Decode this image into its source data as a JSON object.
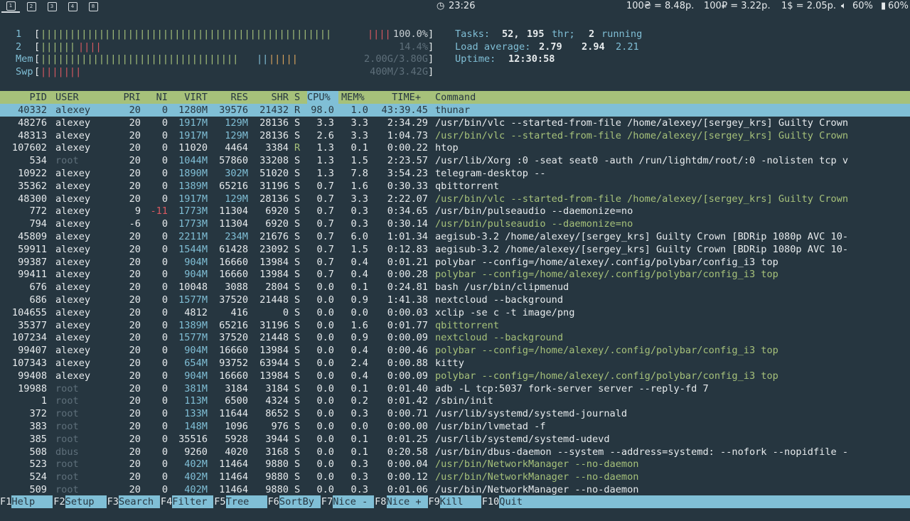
{
  "topbar": {
    "workspaces": [
      "1",
      "2",
      "3",
      "4",
      "8"
    ],
    "clock": "23:26",
    "rate_uah": "100₴ = 8.48р.",
    "rate_rub": "100₽ = 3.22р.",
    "rate_usd": "1$ = 2.05р.",
    "volume": "60%",
    "battery": "60%"
  },
  "meters": {
    "cpu1": {
      "label": "1",
      "value": "100.0%"
    },
    "cpu2": {
      "label": "2",
      "value": "14.4%"
    },
    "mem": {
      "label": "Mem",
      "value": "2.00G/3.80G"
    },
    "swp": {
      "label": "Swp",
      "value": "400M/3.42G"
    }
  },
  "summary": {
    "tasks_label": "Tasks:",
    "tasks_count": "52,",
    "thr_count": "195",
    "thr_label": "thr;",
    "running_count": "2",
    "running_label": "running",
    "load_label": "Load average:",
    "load1": "2.79",
    "load5": "2.94",
    "load15": "2.21",
    "uptime_label": "Uptime:",
    "uptime": "12:30:58"
  },
  "columns": {
    "pid": "PID",
    "user": "USER",
    "pri": "PRI",
    "ni": "NI",
    "virt": "VIRT",
    "res": "RES",
    "shr": "SHR",
    "s": "S",
    "cpu": "CPU%",
    "mem": "MEM%",
    "time": "TIME+",
    "command": "Command"
  },
  "processes": [
    {
      "pid": "40332",
      "user": "alexey",
      "pri": "20",
      "ni": "0",
      "virt": "1280M",
      "res": "39576",
      "shr": "21432",
      "s": "R",
      "cpu": "98.0",
      "mem": "1.0",
      "time": "43:39.45",
      "command": "thunar",
      "selected": true
    },
    {
      "pid": "48276",
      "user": "alexey",
      "pri": "20",
      "ni": "0",
      "virt": "1917M",
      "res": "129M",
      "shr": "28136",
      "s": "S",
      "cpu": "3.3",
      "mem": "3.3",
      "time": "2:34.29",
      "command": "/usr/bin/vlc --started-from-file /home/alexey/[sergey_krs] Guilty Crown"
    },
    {
      "pid": "48313",
      "user": "alexey",
      "pri": "20",
      "ni": "0",
      "virt": "1917M",
      "res": "129M",
      "shr": "28136",
      "s": "S",
      "cpu": "2.6",
      "mem": "3.3",
      "time": "1:04.73",
      "command": "/usr/bin/vlc --started-from-file /home/alexey/[sergey_krs] Guilty Crown",
      "thread": true
    },
    {
      "pid": "107602",
      "user": "alexey",
      "pri": "20",
      "ni": "0",
      "virt": "11020",
      "res": "4464",
      "shr": "3384",
      "s": "R",
      "cpu": "1.3",
      "mem": "0.1",
      "time": "0:00.22",
      "command": "htop"
    },
    {
      "pid": "534",
      "user": "root",
      "pri": "20",
      "ni": "0",
      "virt": "1044M",
      "res": "57860",
      "shr": "33208",
      "s": "S",
      "cpu": "1.3",
      "mem": "1.5",
      "time": "2:23.57",
      "command": "/usr/lib/Xorg :0 -seat seat0 -auth /run/lightdm/root/:0 -nolisten tcp v"
    },
    {
      "pid": "10922",
      "user": "alexey",
      "pri": "20",
      "ni": "0",
      "virt": "1890M",
      "res": "302M",
      "shr": "51020",
      "s": "S",
      "cpu": "1.3",
      "mem": "7.8",
      "time": "3:54.23",
      "command": "telegram-desktop --"
    },
    {
      "pid": "35362",
      "user": "alexey",
      "pri": "20",
      "ni": "0",
      "virt": "1389M",
      "res": "65216",
      "shr": "31196",
      "s": "S",
      "cpu": "0.7",
      "mem": "1.6",
      "time": "0:30.33",
      "command": "qbittorrent"
    },
    {
      "pid": "48300",
      "user": "alexey",
      "pri": "20",
      "ni": "0",
      "virt": "1917M",
      "res": "129M",
      "shr": "28136",
      "s": "S",
      "cpu": "0.7",
      "mem": "3.3",
      "time": "2:22.07",
      "command": "/usr/bin/vlc --started-from-file /home/alexey/[sergey_krs] Guilty Crown",
      "thread": true
    },
    {
      "pid": "772",
      "user": "alexey",
      "pri": "9",
      "ni": "-11",
      "virt": "1773M",
      "res": "11304",
      "shr": "6920",
      "s": "S",
      "cpu": "0.7",
      "mem": "0.3",
      "time": "0:34.65",
      "command": "/usr/bin/pulseaudio --daemonize=no"
    },
    {
      "pid": "794",
      "user": "alexey",
      "pri": "-6",
      "ni": "0",
      "virt": "1773M",
      "res": "11304",
      "shr": "6920",
      "s": "S",
      "cpu": "0.7",
      "mem": "0.3",
      "time": "0:30.14",
      "command": "/usr/bin/pulseaudio --daemonize=no",
      "thread": true
    },
    {
      "pid": "45809",
      "user": "alexey",
      "pri": "20",
      "ni": "0",
      "virt": "2211M",
      "res": "234M",
      "shr": "21676",
      "s": "S",
      "cpu": "0.7",
      "mem": "6.0",
      "time": "1:01.34",
      "command": "aegisub-3.2 /home/alexey/[sergey_krs] Guilty Crown [BDRip 1080p AVC 10-"
    },
    {
      "pid": "59911",
      "user": "alexey",
      "pri": "20",
      "ni": "0",
      "virt": "1544M",
      "res": "61428",
      "shr": "23092",
      "s": "S",
      "cpu": "0.7",
      "mem": "1.5",
      "time": "0:12.83",
      "command": "aegisub-3.2 /home/alexey/[sergey_krs] Guilty Crown [BDRip 1080p AVC 10-"
    },
    {
      "pid": "99387",
      "user": "alexey",
      "pri": "20",
      "ni": "0",
      "virt": "904M",
      "res": "16660",
      "shr": "13984",
      "s": "S",
      "cpu": "0.7",
      "mem": "0.4",
      "time": "0:01.21",
      "command": "polybar --config=/home/alexey/.config/polybar/config_i3 top"
    },
    {
      "pid": "99411",
      "user": "alexey",
      "pri": "20",
      "ni": "0",
      "virt": "904M",
      "res": "16660",
      "shr": "13984",
      "s": "S",
      "cpu": "0.7",
      "mem": "0.4",
      "time": "0:00.28",
      "command": "polybar --config=/home/alexey/.config/polybar/config_i3 top",
      "thread": true
    },
    {
      "pid": "676",
      "user": "alexey",
      "pri": "20",
      "ni": "0",
      "virt": "10048",
      "res": "3088",
      "shr": "2804",
      "s": "S",
      "cpu": "0.0",
      "mem": "0.1",
      "time": "0:24.81",
      "command": "bash /usr/bin/clipmenud"
    },
    {
      "pid": "686",
      "user": "alexey",
      "pri": "20",
      "ni": "0",
      "virt": "1577M",
      "res": "37520",
      "shr": "21448",
      "s": "S",
      "cpu": "0.0",
      "mem": "0.9",
      "time": "1:41.38",
      "command": "nextcloud --background"
    },
    {
      "pid": "104655",
      "user": "alexey",
      "pri": "20",
      "ni": "0",
      "virt": "4812",
      "res": "416",
      "shr": "0",
      "s": "S",
      "cpu": "0.0",
      "mem": "0.0",
      "time": "0:00.03",
      "command": "xclip -se c -t image/png"
    },
    {
      "pid": "35377",
      "user": "alexey",
      "pri": "20",
      "ni": "0",
      "virt": "1389M",
      "res": "65216",
      "shr": "31196",
      "s": "S",
      "cpu": "0.0",
      "mem": "1.6",
      "time": "0:01.77",
      "command": "qbittorrent",
      "thread": true
    },
    {
      "pid": "107234",
      "user": "alexey",
      "pri": "20",
      "ni": "0",
      "virt": "1577M",
      "res": "37520",
      "shr": "21448",
      "s": "S",
      "cpu": "0.0",
      "mem": "0.9",
      "time": "0:00.09",
      "command": "nextcloud --background",
      "thread": true
    },
    {
      "pid": "99407",
      "user": "alexey",
      "pri": "20",
      "ni": "0",
      "virt": "904M",
      "res": "16660",
      "shr": "13984",
      "s": "S",
      "cpu": "0.0",
      "mem": "0.4",
      "time": "0:00.46",
      "command": "polybar --config=/home/alexey/.config/polybar/config_i3 top",
      "thread": true
    },
    {
      "pid": "107343",
      "user": "alexey",
      "pri": "20",
      "ni": "0",
      "virt": "654M",
      "res": "93752",
      "shr": "63944",
      "s": "S",
      "cpu": "0.0",
      "mem": "2.4",
      "time": "0:00.88",
      "command": "kitty"
    },
    {
      "pid": "99408",
      "user": "alexey",
      "pri": "20",
      "ni": "0",
      "virt": "904M",
      "res": "16660",
      "shr": "13984",
      "s": "S",
      "cpu": "0.0",
      "mem": "0.4",
      "time": "0:00.09",
      "command": "polybar --config=/home/alexey/.config/polybar/config_i3 top",
      "thread": true
    },
    {
      "pid": "19988",
      "user": "root",
      "pri": "20",
      "ni": "0",
      "virt": "381M",
      "res": "3184",
      "shr": "3184",
      "s": "S",
      "cpu": "0.0",
      "mem": "0.1",
      "time": "0:01.40",
      "command": "adb -L tcp:5037 fork-server server --reply-fd 7"
    },
    {
      "pid": "1",
      "user": "root",
      "pri": "20",
      "ni": "0",
      "virt": "113M",
      "res": "6500",
      "shr": "4324",
      "s": "S",
      "cpu": "0.0",
      "mem": "0.2",
      "time": "0:01.42",
      "command": "/sbin/init"
    },
    {
      "pid": "372",
      "user": "root",
      "pri": "20",
      "ni": "0",
      "virt": "133M",
      "res": "11644",
      "shr": "8652",
      "s": "S",
      "cpu": "0.0",
      "mem": "0.3",
      "time": "0:00.71",
      "command": "/usr/lib/systemd/systemd-journald"
    },
    {
      "pid": "383",
      "user": "root",
      "pri": "20",
      "ni": "0",
      "virt": "148M",
      "res": "1096",
      "shr": "976",
      "s": "S",
      "cpu": "0.0",
      "mem": "0.0",
      "time": "0:00.00",
      "command": "/usr/bin/lvmetad -f"
    },
    {
      "pid": "385",
      "user": "root",
      "pri": "20",
      "ni": "0",
      "virt": "35516",
      "res": "5928",
      "shr": "3944",
      "s": "S",
      "cpu": "0.0",
      "mem": "0.1",
      "time": "0:01.25",
      "command": "/usr/lib/systemd/systemd-udevd"
    },
    {
      "pid": "508",
      "user": "dbus",
      "pri": "20",
      "ni": "0",
      "virt": "9260",
      "res": "4020",
      "shr": "3168",
      "s": "S",
      "cpu": "0.0",
      "mem": "0.1",
      "time": "0:20.58",
      "command": "/usr/bin/dbus-daemon --system --address=systemd: --nofork --nopidfile -"
    },
    {
      "pid": "523",
      "user": "root",
      "pri": "20",
      "ni": "0",
      "virt": "402M",
      "res": "11464",
      "shr": "9880",
      "s": "S",
      "cpu": "0.0",
      "mem": "0.3",
      "time": "0:00.04",
      "command": "/usr/bin/NetworkManager --no-daemon",
      "thread": true
    },
    {
      "pid": "524",
      "user": "root",
      "pri": "20",
      "ni": "0",
      "virt": "402M",
      "res": "11464",
      "shr": "9880",
      "s": "S",
      "cpu": "0.0",
      "mem": "0.3",
      "time": "0:00.12",
      "command": "/usr/bin/NetworkManager --no-daemon",
      "thread": true
    },
    {
      "pid": "509",
      "user": "root",
      "pri": "20",
      "ni": "0",
      "virt": "402M",
      "res": "11464",
      "shr": "9880",
      "s": "S",
      "cpu": "0.0",
      "mem": "0.3",
      "time": "0:01.06",
      "command": "/usr/bin/NetworkManager --no-daemon"
    }
  ],
  "footer": [
    {
      "key": "F1",
      "label": "Help"
    },
    {
      "key": "F2",
      "label": "Setup"
    },
    {
      "key": "F3",
      "label": "Search"
    },
    {
      "key": "F4",
      "label": "Filter"
    },
    {
      "key": "F5",
      "label": "Tree"
    },
    {
      "key": "F6",
      "label": "SortBy"
    },
    {
      "key": "F7",
      "label": "Nice -"
    },
    {
      "key": "F8",
      "label": "Nice +"
    },
    {
      "key": "F9",
      "label": "Kill"
    },
    {
      "key": "F10",
      "label": "Quit"
    }
  ],
  "colors": {
    "background": "#263640",
    "header": "#a6c17a",
    "selection": "#80bfd6"
  }
}
